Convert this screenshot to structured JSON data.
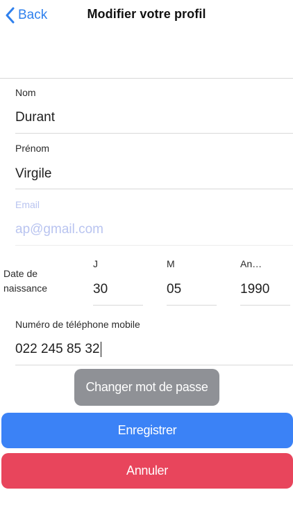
{
  "header": {
    "back_label": "Back",
    "title": "Modifier votre profil"
  },
  "form": {
    "nom": {
      "label": "Nom",
      "value": "Durant"
    },
    "prenom": {
      "label": "Prénom",
      "value": "Virgile"
    },
    "email": {
      "label": "Email",
      "value": "ap@gmail.com"
    },
    "birth": {
      "label_line1": "Date de",
      "label_line2": "naissance",
      "day": {
        "label": "J",
        "value": "30"
      },
      "month": {
        "label": "M",
        "value": "05"
      },
      "year": {
        "label": "An…",
        "value": "1990"
      }
    },
    "phone": {
      "label": "Numéro de téléphone mobile",
      "value": "022 245 85 32"
    }
  },
  "buttons": {
    "change_password": "Changer mot de passe",
    "save": "Enregistrer",
    "cancel": "Annuler"
  },
  "colors": {
    "accent": "#2f80ed",
    "save": "#3b82f6",
    "cancel": "#e8455c",
    "secondary": "#8f9196"
  }
}
